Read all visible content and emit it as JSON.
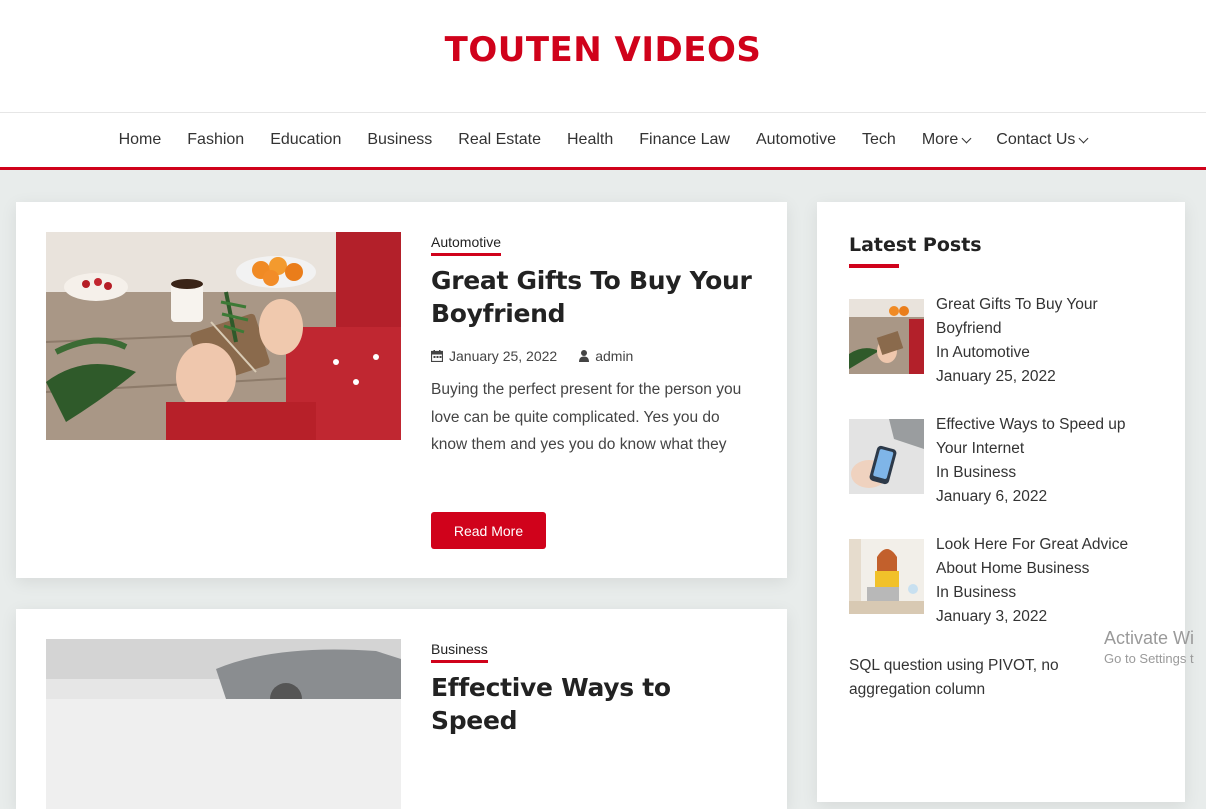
{
  "site": {
    "title": "TOUTEN VIDEOS"
  },
  "nav": {
    "items": [
      "Home",
      "Fashion",
      "Education",
      "Business",
      "Real Estate",
      "Health",
      "Finance Law",
      "Automotive",
      "Tech"
    ],
    "more_label": "More",
    "contact_label": "Contact Us"
  },
  "posts": [
    {
      "category": "Automotive",
      "title": "Great Gifts To Buy Your Boyfriend",
      "date": "January 25, 2022",
      "author": "admin",
      "excerpt": "Buying the perfect present for the person you love can be quite complicated. Yes you do know them and yes you do know what they",
      "read_more": "Read More"
    },
    {
      "category": "Business",
      "title": "Effective Ways to Speed"
    }
  ],
  "sidebar": {
    "title": "Latest Posts",
    "items": [
      {
        "title_line1": "Great Gifts To Buy Your",
        "title_line2": "Boyfriend",
        "category": "In Automotive",
        "date": "January 25, 2022"
      },
      {
        "title_line1": "Effective Ways to Speed up",
        "title_line2": "Your Internet",
        "category": "In Business",
        "date": "January 6, 2022"
      },
      {
        "title_line1": "Look Here For Great Advice",
        "title_line2": "About Home Business",
        "category": "In Business",
        "date": "January 3, 2022"
      }
    ],
    "plain_item": {
      "line1": "SQL question using PIVOT, no",
      "line2": "aggregation column"
    }
  },
  "watermark": {
    "line1": "Activate Wi",
    "line2": "Go to Settings t"
  },
  "colors": {
    "accent": "#d0021b",
    "background": "#e8eceb"
  },
  "icons": [
    "calendar-icon",
    "user-icon",
    "chevron-down-icon"
  ]
}
